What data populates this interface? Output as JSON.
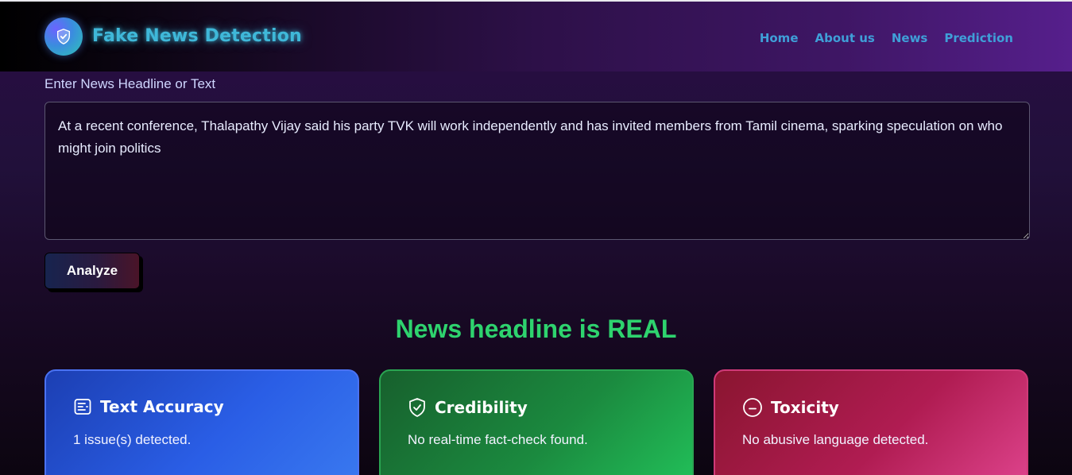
{
  "header": {
    "brand": "Fake News Detection",
    "logo_icon": "shield-check-icon",
    "nav": [
      "Home",
      "About us",
      "News",
      "Prediction"
    ]
  },
  "form": {
    "label": "Enter News Headline or Text",
    "text_value": "At a recent conference, Thalapathy Vijay said his party TVK will work independently and has invited members from Tamil cinema, sparking speculation on who might join politics",
    "analyze_label": "Analyze"
  },
  "result": {
    "headline": "News headline is REAL",
    "color": "#2ed36e"
  },
  "cards": [
    {
      "title": "Text Accuracy",
      "icon": "document-icon",
      "text": "1 issue(s) detected.",
      "color": "#2a5ee6"
    },
    {
      "title": "Credibility",
      "icon": "shield-check-icon",
      "text": "No real-time fact-check found.",
      "color": "#1b8a3f"
    },
    {
      "title": "Toxicity",
      "icon": "minus-circle-icon",
      "text": "No abusive language detected.",
      "color": "#b01c52"
    }
  ]
}
